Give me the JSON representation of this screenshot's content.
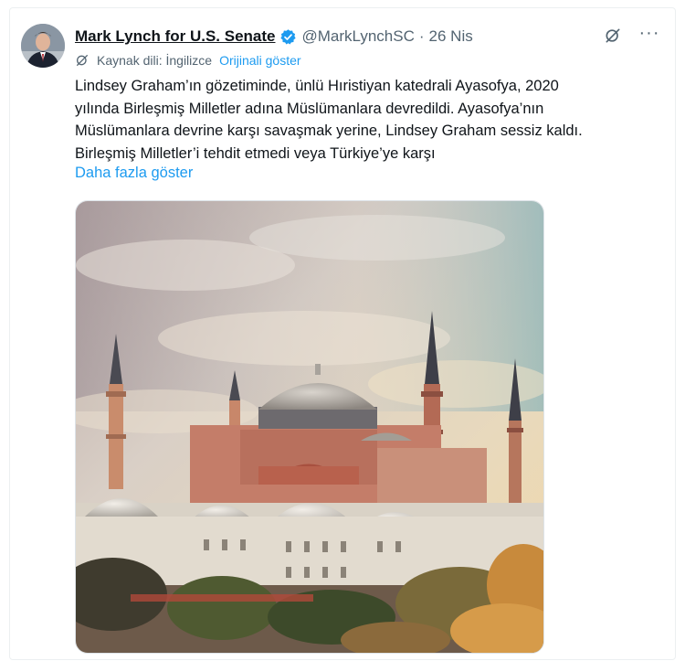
{
  "tweet": {
    "author_name": "Mark Lynch for U.S. Senate",
    "handle": "@MarkLynchSC",
    "separator": "·",
    "date": "26 Nis",
    "translation_source": "Kaynak dili: İngilizce",
    "show_original": "Orijinali göster",
    "text_lines": [
      "Lindsey Graham’ın gözetiminde, ünlü Hıristiyan katedrali Ayasofya, 2020",
      "yılında Birleşmiş Milletler adına Müslümanlara devredildi. Ayasofya’nın",
      "Müslümanlara devrine karşı savaşmak yerine, Lindsey Graham sessiz kaldı.",
      "Birleşmiş Milletler’i tehdit etmedi veya Türkiye’ye karşı"
    ],
    "show_more": "Daha fazla göster",
    "more_icon": "···"
  },
  "icons": {
    "verified": "verified-badge-icon",
    "grok": "grok-icon",
    "translate": "translate-icon",
    "more": "more-icon"
  },
  "colors": {
    "link": "#1d9bf0",
    "secondary_text": "#536471",
    "verified": "#1d9bf0"
  }
}
